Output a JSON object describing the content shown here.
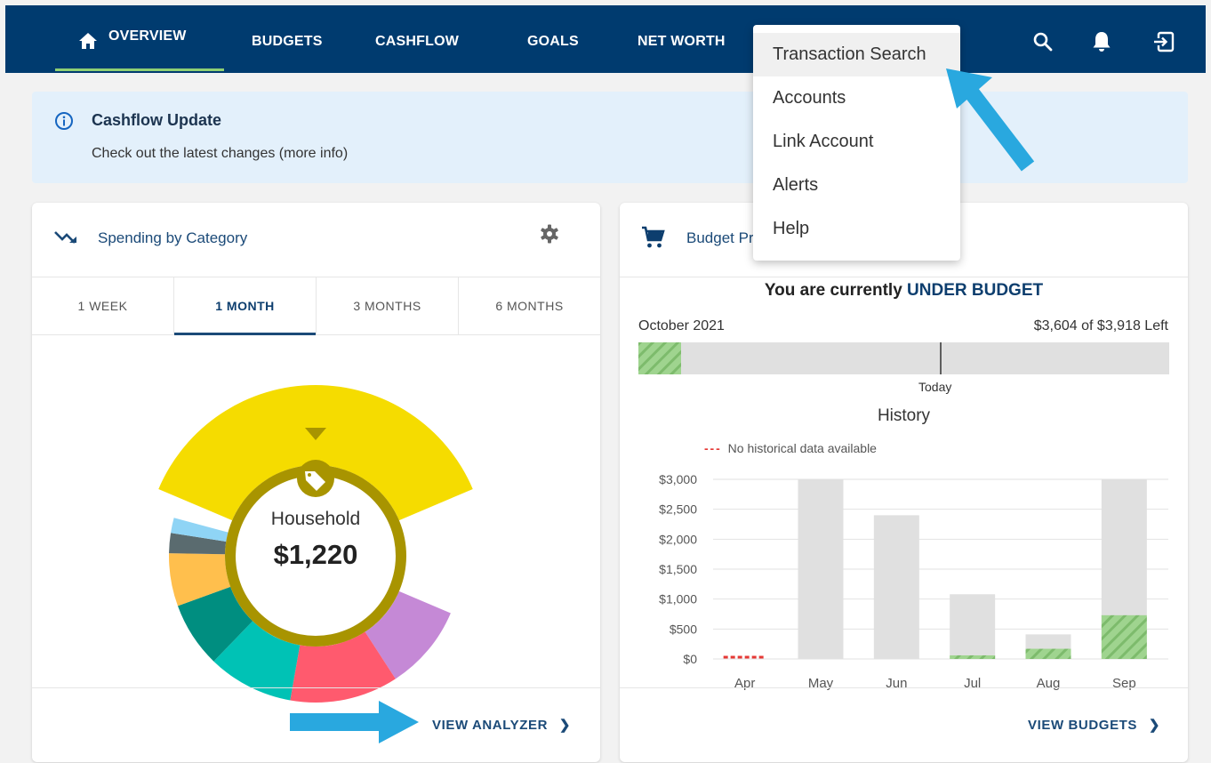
{
  "nav": {
    "overview": "OVERVIEW",
    "budgets": "BUDGETS",
    "cashflow": "CASHFLOW",
    "goals": "GOALS",
    "net_worth": "NET WORTH"
  },
  "menu": {
    "items": [
      "Transaction Search",
      "Accounts",
      "Link Account",
      "Alerts",
      "Help"
    ],
    "highlighted": "Transaction Search"
  },
  "banner": {
    "title": "Cashflow Update",
    "text": "Check out the latest changes (more info)"
  },
  "spending": {
    "title": "Spending by Category",
    "tabs": [
      "1 WEEK",
      "1 MONTH",
      "3 MONTHS",
      "6 MONTHS"
    ],
    "active_tab": "1 MONTH",
    "center_label": "Household",
    "center_value": "$1,220",
    "view_label": "VIEW ANALYZER",
    "donut_colors": {
      "household": "#f5dc00",
      "purple": "#c589d6",
      "red": "#ff5a6e",
      "teal": "#00c2b5",
      "dark_teal": "#008e80",
      "orange": "#ffbf4d",
      "slate": "#5a6b6f",
      "light_blue": "#8fd4f5",
      "ring": "#a89400"
    }
  },
  "budget": {
    "title": "Budget Progress",
    "status_prefix": "You are currently",
    "status_value": "UNDER BUDGET",
    "month": "October 2021",
    "remaining": "$3,604 of $3,918 Left",
    "spent_fraction": 0.08,
    "today_fraction": 0.57,
    "today_label": "Today",
    "history_title": "History",
    "history_legend": "No historical data available",
    "view_label": "VIEW BUDGETS"
  },
  "chart_data": {
    "type": "bar",
    "categories": [
      "Apr",
      "May",
      "Jun",
      "Jul",
      "Aug",
      "Sep"
    ],
    "ylim": [
      0,
      3000
    ],
    "yticks": [
      "$3,000",
      "$2,500",
      "$2,000",
      "$1,500",
      "$1,000",
      "$500",
      "$0"
    ],
    "series": [
      {
        "values": [
          0,
          3000,
          2400,
          1080,
          410,
          3000
        ],
        "color": "#e0e0e0"
      },
      {
        "values": [
          0,
          0,
          0,
          60,
          170,
          730
        ],
        "color": "#9fd48f"
      }
    ],
    "no_data_months": [
      "Apr"
    ]
  }
}
